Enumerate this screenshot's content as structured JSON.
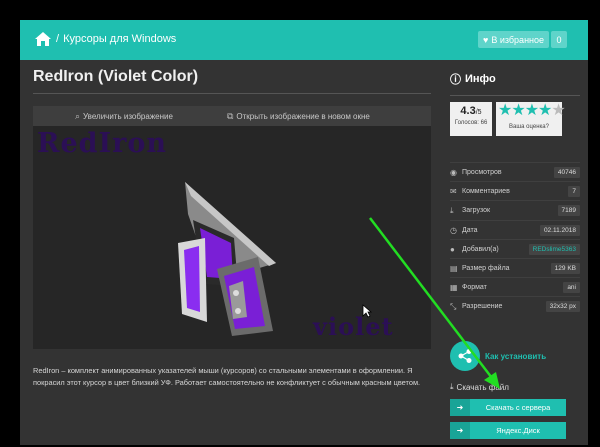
{
  "header": {
    "breadcrumb_sep": "/",
    "breadcrumb": "Курсоры для Windows",
    "favorites_label": "В избранное",
    "favorites_count": "0"
  },
  "page": {
    "title": "RedIron (Violet Color)"
  },
  "viewer": {
    "enlarge": "Увеличить изображение",
    "open_new_window": "Открыть изображение в новом окне",
    "preview_text_top": "RedIron",
    "preview_text_bottom": "violet"
  },
  "description": "RedIron – комплект анимированных указателей мыши (курсоров) со стальными элементами в оформлении. Я покрасил этот курсор в цвет близкий УФ. Работает самостоятельно не конфликтует с обычным красным цветом.",
  "info": {
    "title": "Инфо",
    "rating": "4.3",
    "rating_max": "/5",
    "votes": "Голосов: 66",
    "stars_filled": 4,
    "your_rating": "Ваша оценка?",
    "stats": [
      {
        "icon": "eye-icon",
        "label": "Просмотров",
        "value": "40746"
      },
      {
        "icon": "comments-icon",
        "label": "Комментариев",
        "value": "7"
      },
      {
        "icon": "download-icon",
        "label": "Загрузок",
        "value": "7189"
      },
      {
        "icon": "clock-icon",
        "label": "Дата",
        "value": "02.11.2018"
      },
      {
        "icon": "user-icon",
        "label": "Добавил(а)",
        "value": "REDslime5363",
        "link": true
      },
      {
        "icon": "file-icon",
        "label": "Размер файла",
        "value": "129 KB"
      },
      {
        "icon": "format-icon",
        "label": "Формат",
        "value": "ani"
      },
      {
        "icon": "resize-icon",
        "label": "Разрешение",
        "value": "32x32 px"
      }
    ],
    "howto": "Как установить"
  },
  "download": {
    "title": "Скачать файл",
    "server_btn": "Скачать с сервера",
    "yandex_btn": "Яндекс.Диск"
  },
  "colors": {
    "accent": "#1fbfb0",
    "background": "#333333",
    "arrow": "#22dd22"
  }
}
